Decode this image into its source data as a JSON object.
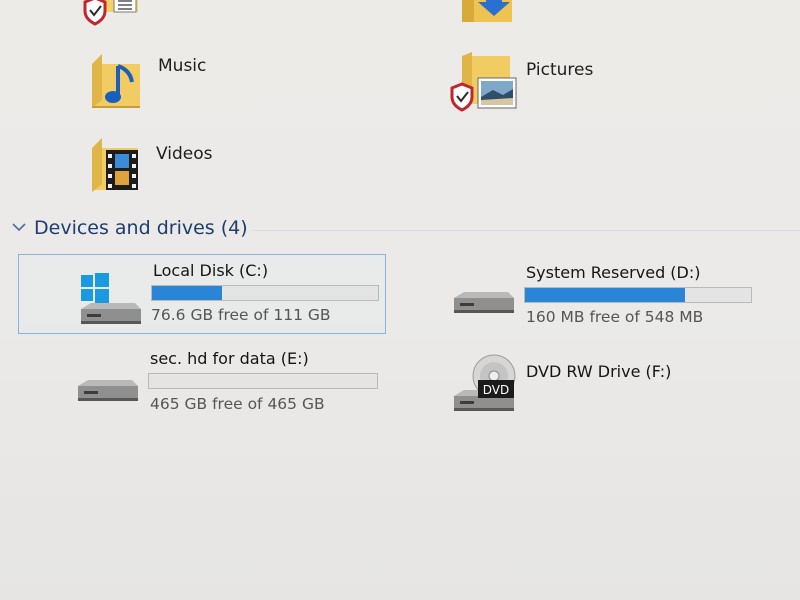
{
  "folders": [
    {
      "name": "Music"
    },
    {
      "name": "Pictures"
    },
    {
      "name": "Videos"
    }
  ],
  "section": {
    "title": "Devices and drives (4)"
  },
  "drives": [
    {
      "name": "Local Disk (C:)",
      "free_text": "76.6 GB free of 111 GB",
      "used_fraction": 0.31,
      "icon": "windows-drive-icon",
      "selected": true
    },
    {
      "name": "System Reserved (D:)",
      "free_text": "160 MB free of 548 MB",
      "used_fraction": 0.71,
      "icon": "hard-drive-icon",
      "selected": false
    },
    {
      "name": "sec. hd for data  (E:)",
      "free_text": "465 GB free of 465 GB",
      "used_fraction": 0.0,
      "icon": "hard-drive-icon",
      "selected": false
    },
    {
      "name": "DVD RW Drive (F:)",
      "icon": "dvd-drive-icon",
      "dvd_badge": "DVD",
      "selected": false
    }
  ],
  "colors": {
    "bar_fill": "#2a85d6",
    "section_title": "#1d3e6e",
    "selection_border": "#88b4e0"
  }
}
